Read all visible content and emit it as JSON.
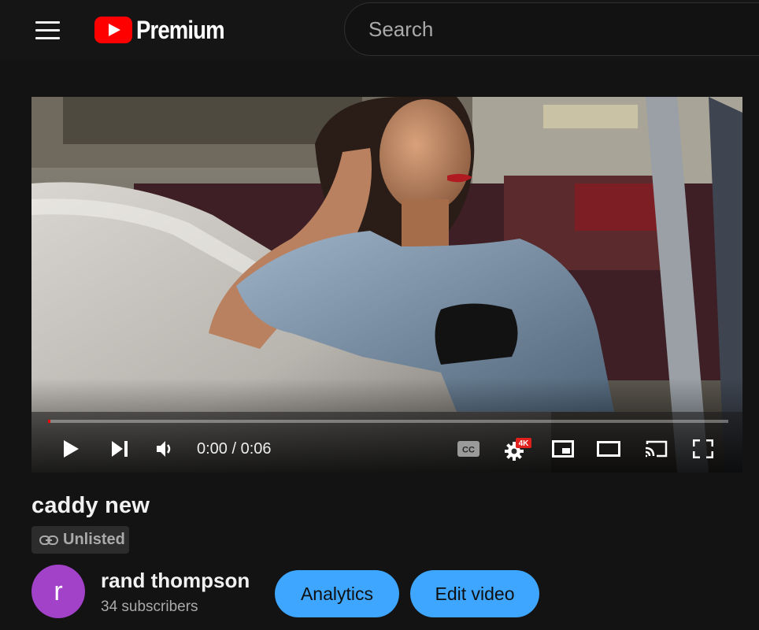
{
  "header": {
    "logo_text": "Premium",
    "search_placeholder": "Search"
  },
  "player": {
    "current_time": "0:00",
    "duration": "0:06",
    "time_display": "0:00 / 0:06",
    "progress": 0.003,
    "quality_badge": "4K",
    "cc_label": "CC"
  },
  "video": {
    "title": "caddy new",
    "visibility": "Unlisted"
  },
  "channel": {
    "avatar_letter": "r",
    "name": "rand thompson",
    "subscribers": "34 subscribers"
  },
  "actions": {
    "analytics_label": "Analytics",
    "edit_label": "Edit video"
  },
  "colors": {
    "accent": "#3ea6ff",
    "brand_red": "#ff0000",
    "avatar": "#a142c9",
    "background": "#131313"
  }
}
